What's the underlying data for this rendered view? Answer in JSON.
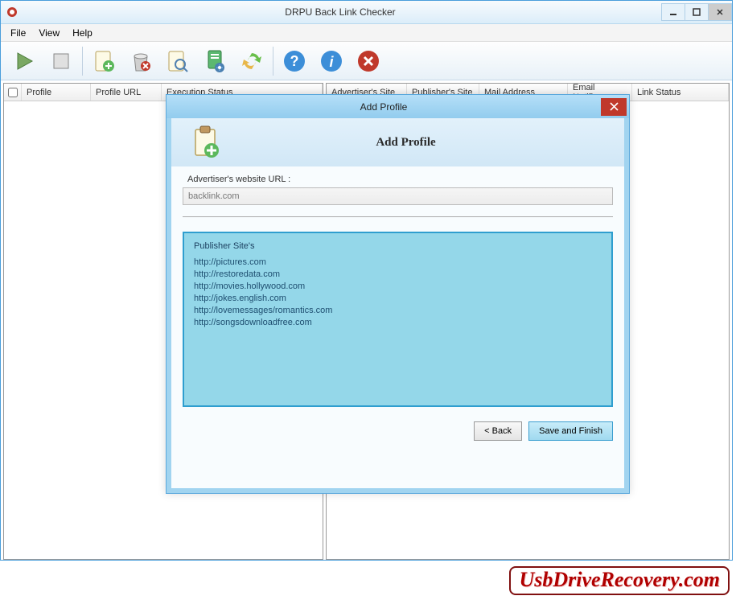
{
  "window": {
    "title": "DRPU Back Link Checker"
  },
  "menu": {
    "file": "File",
    "view": "View",
    "help": "Help"
  },
  "toolbar_icons": {
    "play": "play-icon",
    "stop": "stop-icon",
    "add_profile": "add-profile-icon",
    "delete": "delete-icon",
    "search": "search-icon",
    "settings": "settings-icon",
    "refresh": "refresh-icon",
    "help": "help-icon",
    "info": "info-icon",
    "close": "close-icon"
  },
  "left_columns": {
    "profile": "Profile",
    "profile_url": "Profile URL",
    "execution_status": "Execution Status"
  },
  "right_columns": {
    "advertiser_site": "Advertiser's Site",
    "publisher_site": "Publisher's Site",
    "mail_address": "Mail Address",
    "email_notific": "Email Notific...",
    "link_status": "Link Status"
  },
  "dialog": {
    "titlebar": "Add Profile",
    "header_title": "Add Profile",
    "url_label": "Advertiser's website URL :",
    "url_value": "backlink.com",
    "publisher_title": "Publisher Site's",
    "publisher_urls": [
      "http://pictures.com",
      "http://restoredata.com",
      "http://movies.hollywood.com",
      "http://jokes.english.com",
      "http://lovemessages/romantics.com",
      "http://songsdownloadfree.com"
    ],
    "back_btn": "< Back",
    "save_btn": "Save and Finish"
  },
  "watermark": "UsbDriveRecovery.com"
}
